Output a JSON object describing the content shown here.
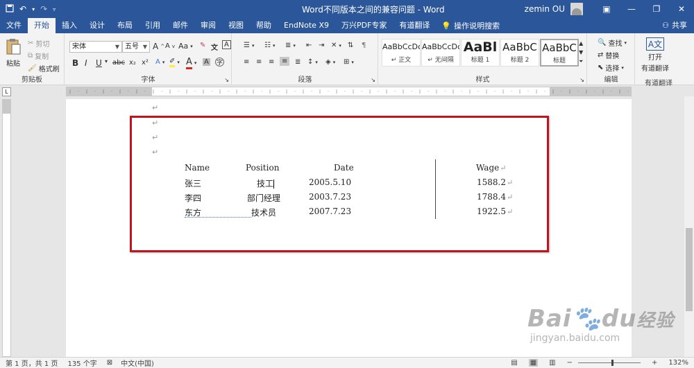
{
  "titlebar": {
    "title": "Word不同版本之间的兼容问题 - Word",
    "user": "zemin OU",
    "save_icon": "save-icon",
    "undo_icon": "undo-icon",
    "redo_icon": "redo-icon"
  },
  "tabs": [
    "文件",
    "开始",
    "插入",
    "设计",
    "布局",
    "引用",
    "邮件",
    "审阅",
    "视图",
    "帮助",
    "EndNote X9",
    "万兴PDF专家",
    "有道翻译"
  ],
  "active_tab": "开始",
  "search_label": "操作说明搜索",
  "share_label": "共享",
  "ribbon": {
    "clipboard": {
      "paste": "粘贴",
      "cut": "剪切",
      "copy": "复制",
      "format_painter": "格式刷",
      "label": "剪贴板"
    },
    "font": {
      "font_name": "宋体",
      "font_size": "五号",
      "label": "字体",
      "grow": "A",
      "shrink": "A",
      "case": "Aa",
      "bold": "B",
      "italic": "I",
      "underline": "U",
      "strike": "abc",
      "subscript": "x₂",
      "superscript": "x²",
      "color_a": "A"
    },
    "paragraph": {
      "label": "段落"
    },
    "styles": {
      "label": "样式",
      "items": [
        {
          "sample": "AaBbCcDc",
          "name": "正文"
        },
        {
          "sample": "AaBbCcDc",
          "name": "无间隔"
        },
        {
          "sample": "AaBl",
          "name": "标题 1"
        },
        {
          "sample": "AaBbC",
          "name": "标题 2"
        },
        {
          "sample": "AaBbC",
          "name": "标题"
        }
      ]
    },
    "editing": {
      "label": "编辑",
      "find": "查找",
      "replace": "替换",
      "select": "选择"
    },
    "translate": {
      "label": "有道翻译",
      "open": "打开",
      "open2": "有道翻译"
    }
  },
  "document": {
    "headers": [
      "Name",
      "Position",
      "Date",
      "Wage"
    ],
    "rows": [
      {
        "name": "张三",
        "position": "技工",
        "date": "2005.5.10",
        "wage": "1588.2"
      },
      {
        "name": "李四",
        "position": "部门经理",
        "date": "2003.7.23",
        "wage": "1788.4"
      },
      {
        "name": "东方",
        "position": "技术员",
        "date": "2007.7.23",
        "wage": "1922.5"
      }
    ],
    "para_mark": "↵"
  },
  "statusbar": {
    "page": "第 1 页，共 1 页",
    "words": "135 个字",
    "lang": "中文(中国)",
    "zoom": "132%",
    "zoom_fraction": 0.55
  },
  "watermark": {
    "brand": "Bai",
    "brand2": "du",
    "cn": "经验",
    "url": "jingyan.baidu.com"
  },
  "colors": {
    "brand": "#2b579a",
    "highlight": "#c0141c"
  }
}
